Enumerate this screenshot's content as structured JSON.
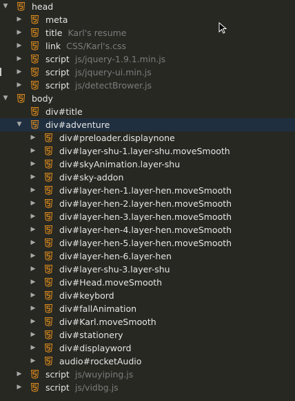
{
  "colors": {
    "background": "#272822",
    "selected_row": "#1f2f40",
    "html5_icon_orange": "#e8911d",
    "tag_text": "#e6e6e6",
    "attr_text": "#7c7c7c",
    "arrow": "#a9a9a9"
  },
  "icons": {
    "expanded": "▼",
    "collapsed": "▶",
    "file": "html5-file-icon",
    "cursor": "mouse-pointer-icon"
  },
  "nodes": [
    {
      "tag": "head",
      "detail": "",
      "depth": 0,
      "state": "expanded"
    },
    {
      "tag": "meta",
      "detail": "",
      "depth": 1,
      "state": "collapsed"
    },
    {
      "tag": "title",
      "detail": "Karl's resume",
      "depth": 1,
      "state": "collapsed"
    },
    {
      "tag": "link",
      "detail": "CSS/Karl's.css",
      "depth": 1,
      "state": "collapsed"
    },
    {
      "tag": "script",
      "detail": "js/jquery-1.9.1.min.js",
      "depth": 1,
      "state": "collapsed"
    },
    {
      "tag": "script",
      "detail": "js/jquery-ui.min.js",
      "depth": 1,
      "state": "collapsed"
    },
    {
      "tag": "script",
      "detail": "js/detectBrower.js",
      "depth": 1,
      "state": "collapsed"
    },
    {
      "tag": "body",
      "detail": "",
      "depth": 0,
      "state": "expanded"
    },
    {
      "tag": "div#title",
      "detail": "",
      "depth": 1,
      "state": "none"
    },
    {
      "tag": "div#adventure",
      "detail": "",
      "depth": 1,
      "state": "expanded",
      "selected": true
    },
    {
      "tag": "div#preloader.displaynone",
      "detail": "",
      "depth": 2,
      "state": "collapsed"
    },
    {
      "tag": "div#layer-shu-1.layer-shu.moveSmooth",
      "detail": "",
      "depth": 2,
      "state": "collapsed"
    },
    {
      "tag": "div#skyAnimation.layer-shu",
      "detail": "",
      "depth": 2,
      "state": "collapsed"
    },
    {
      "tag": "div#sky-addon",
      "detail": "",
      "depth": 2,
      "state": "collapsed"
    },
    {
      "tag": "div#layer-hen-1.layer-hen.moveSmooth",
      "detail": "",
      "depth": 2,
      "state": "collapsed"
    },
    {
      "tag": "div#layer-hen-2.layer-hen.moveSmooth",
      "detail": "",
      "depth": 2,
      "state": "collapsed"
    },
    {
      "tag": "div#layer-hen-3.layer-hen.moveSmooth",
      "detail": "",
      "depth": 2,
      "state": "collapsed"
    },
    {
      "tag": "div#layer-hen-4.layer-hen.moveSmooth",
      "detail": "",
      "depth": 2,
      "state": "collapsed"
    },
    {
      "tag": "div#layer-hen-5.layer-hen.moveSmooth",
      "detail": "",
      "depth": 2,
      "state": "collapsed"
    },
    {
      "tag": "div#layer-hen-6.layer-hen",
      "detail": "",
      "depth": 2,
      "state": "collapsed"
    },
    {
      "tag": "div#layer-shu-3.layer-shu",
      "detail": "",
      "depth": 2,
      "state": "collapsed"
    },
    {
      "tag": "div#Head.moveSmooth",
      "detail": "",
      "depth": 2,
      "state": "collapsed"
    },
    {
      "tag": "div#keybord",
      "detail": "",
      "depth": 2,
      "state": "collapsed"
    },
    {
      "tag": "div#fallAnimation",
      "detail": "",
      "depth": 2,
      "state": "collapsed"
    },
    {
      "tag": "div#Karl.moveSmooth",
      "detail": "",
      "depth": 2,
      "state": "collapsed"
    },
    {
      "tag": "div#stationery",
      "detail": "",
      "depth": 2,
      "state": "collapsed"
    },
    {
      "tag": "div#displayword",
      "detail": "",
      "depth": 2,
      "state": "collapsed"
    },
    {
      "tag": "audio#rocketAudio",
      "detail": "",
      "depth": 2,
      "state": "collapsed"
    },
    {
      "tag": "script",
      "detail": "js/wuyiping.js",
      "depth": 1,
      "state": "collapsed"
    },
    {
      "tag": "script",
      "detail": "js/vidbg.js",
      "depth": 1,
      "state": "collapsed"
    }
  ]
}
